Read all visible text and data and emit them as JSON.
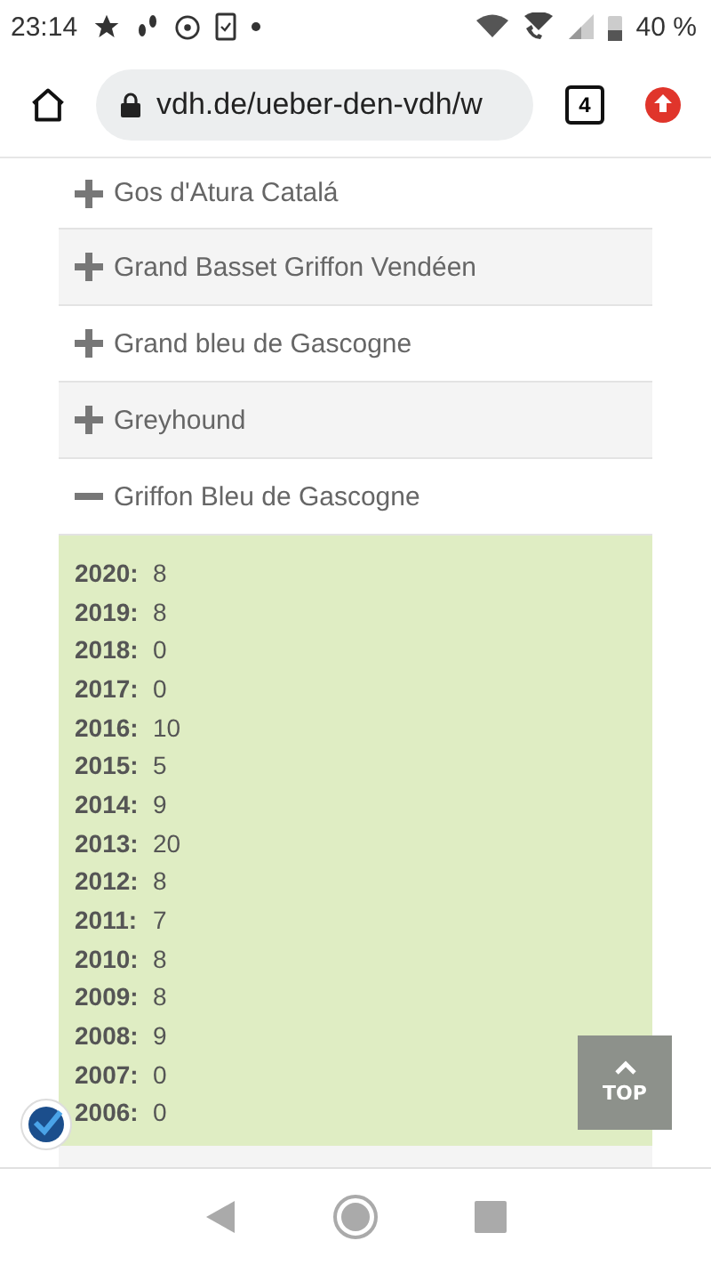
{
  "status_bar": {
    "time": "23:14",
    "battery": "40 %"
  },
  "browser": {
    "url": "vdh.de/ueber-den-vdh/w",
    "tab_count": "4"
  },
  "accordion": [
    {
      "label": "Gos d'Atura Catalá",
      "expanded": false
    },
    {
      "label": "Grand Basset Griffon Vendéen",
      "expanded": false
    },
    {
      "label": "Grand bleu de Gascogne",
      "expanded": false
    },
    {
      "label": "Greyhound",
      "expanded": false
    },
    {
      "label": "Griffon Bleu de Gascogne",
      "expanded": true,
      "rows": [
        {
          "year": "2020:",
          "count": "8"
        },
        {
          "year": "2019:",
          "count": "8"
        },
        {
          "year": "2018:",
          "count": "0"
        },
        {
          "year": "2017:",
          "count": "0"
        },
        {
          "year": "2016:",
          "count": "10"
        },
        {
          "year": "2015:",
          "count": "5"
        },
        {
          "year": "2014:",
          "count": "9"
        },
        {
          "year": "2013:",
          "count": "20"
        },
        {
          "year": "2012:",
          "count": "8"
        },
        {
          "year": "2011:",
          "count": "7"
        },
        {
          "year": "2010:",
          "count": "8"
        },
        {
          "year": "2009:",
          "count": "8"
        },
        {
          "year": "2008:",
          "count": "9"
        },
        {
          "year": "2007:",
          "count": "0"
        },
        {
          "year": "2006:",
          "count": "0"
        }
      ]
    }
  ],
  "top_button": {
    "label": "TOP"
  }
}
